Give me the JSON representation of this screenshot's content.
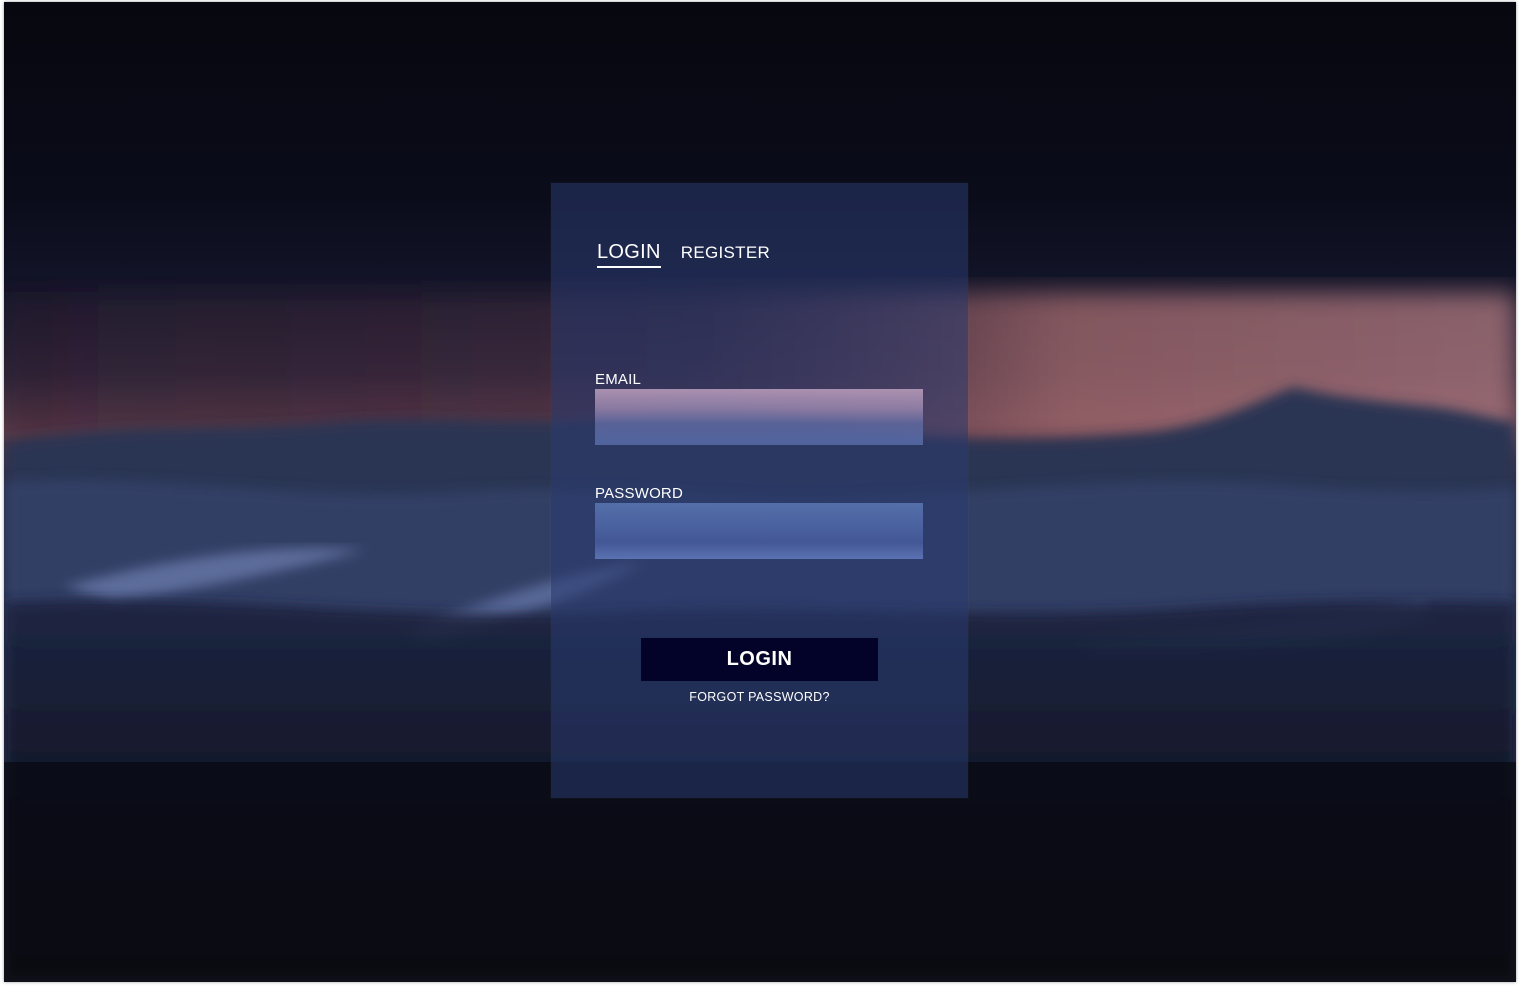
{
  "tabs": {
    "login": "LOGIN",
    "register": "REGISTER"
  },
  "form": {
    "email_label": "EMAIL",
    "password_label": "PASSWORD",
    "email_value": "",
    "password_value": ""
  },
  "actions": {
    "login_button": "LOGIN",
    "forgot_password": "FORGOT PASSWORD?"
  },
  "colors": {
    "panel": "#2a3a70",
    "button": "#03032a",
    "text": "#ffffff",
    "background": "#0b0b17"
  }
}
